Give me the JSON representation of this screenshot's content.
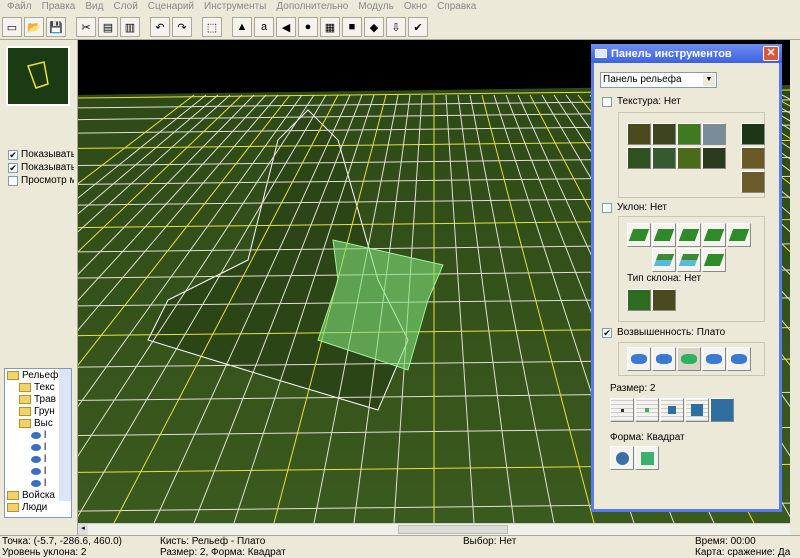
{
  "menu": [
    "Файл",
    "Правка",
    "Вид",
    "Слой",
    "Сценарий",
    "Инструменты",
    "Дополнительно",
    "Модуль",
    "Окно",
    "Справка"
  ],
  "toolbar_icons": [
    "new-icon",
    "open-icon",
    "save-icon",
    "cut-icon",
    "copy-icon",
    "paste-icon",
    "undo-icon",
    "redo-icon",
    "select-icon",
    "terrain-icon",
    "object-icon",
    "sound-icon",
    "unit-icon",
    "building-icon",
    "map-icon",
    "cube-icon",
    "export-icon",
    "test-icon"
  ],
  "left": {
    "checks": [
      {
        "label": "Показывать",
        "checked": true
      },
      {
        "label": "Показывать",
        "checked": true
      },
      {
        "label": "Просмотр м",
        "checked": false
      }
    ],
    "tree": [
      {
        "label": "Рельеф",
        "type": "folder",
        "level": 0
      },
      {
        "label": "Текс",
        "type": "folder",
        "level": 1
      },
      {
        "label": "Трав",
        "type": "folder",
        "level": 1
      },
      {
        "label": "Грун",
        "type": "folder",
        "level": 1
      },
      {
        "label": "Выс",
        "type": "folder",
        "level": 1
      },
      {
        "label": "l",
        "type": "mesh",
        "level": 2
      },
      {
        "label": "l",
        "type": "mesh",
        "level": 2
      },
      {
        "label": "l",
        "type": "mesh",
        "level": 2
      },
      {
        "label": "l",
        "type": "mesh",
        "level": 2
      },
      {
        "label": "l",
        "type": "mesh",
        "level": 2
      },
      {
        "label": "Войска",
        "type": "folder",
        "level": 0
      },
      {
        "label": "Люди",
        "type": "folder",
        "level": 0
      }
    ]
  },
  "panel": {
    "title": "Панель инструментов",
    "dropdown": "Панель рельефа",
    "texture": {
      "label": "Текстура: Нет",
      "checked": false,
      "colors": [
        "#4a4a1e",
        "#3f4420",
        "#3f7a20",
        "#7a8c9a",
        "#2f5020",
        "#355a30",
        "#4c6b1a",
        "#2a3a1c",
        "#1f3518",
        "#6a5a28",
        "#6b5b2a"
      ]
    },
    "slope": {
      "label": "Уклон: Нет",
      "checked": false,
      "type_label": "Тип склона: Нет"
    },
    "elevation": {
      "label": "Возвышенность: Плато",
      "checked": true
    },
    "size": {
      "label": "Размер: 2",
      "options": [
        "1",
        "2",
        "3",
        "5",
        "8"
      ],
      "selected": "2"
    },
    "shape": {
      "label": "Форма: Квадрат",
      "options": [
        "circle",
        "square"
      ],
      "selected": "square"
    }
  },
  "status": {
    "point": "Точка: (-5.7, -286.6, 460.0)",
    "slope_level": "Уровень уклона: 2",
    "brush": "Кисть: Рельеф - Плато",
    "brush_size": "Размер: 2, Форма: Квадрат",
    "selection": "Выбор: Нет",
    "time": "Время: 00:00",
    "battle_map": "Карта: сражение: Да"
  }
}
